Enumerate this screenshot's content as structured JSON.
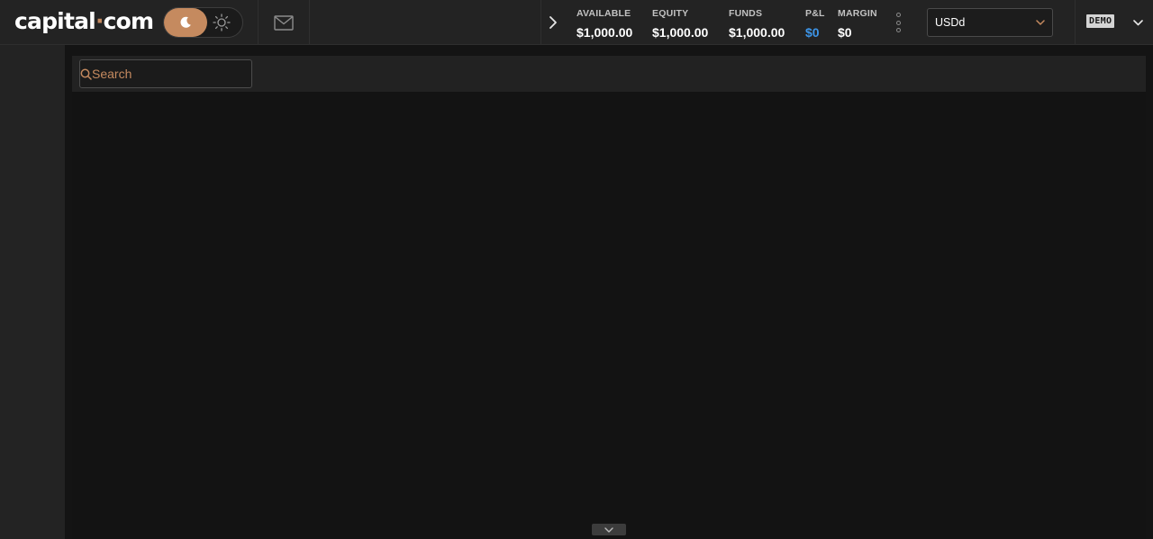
{
  "header": {
    "logo": {
      "prefix": "capital",
      "dot": "·",
      "suffix": "com"
    },
    "theme_toggle": {
      "active": "dark",
      "active_icon": "moon-icon",
      "inactive_icon": "sun-icon"
    },
    "mail_icon": "envelope-icon",
    "collapse_icon": "chevron-right-icon",
    "stats": [
      {
        "label": "AVAILABLE",
        "value": "$1,000.00"
      },
      {
        "label": "EQUITY",
        "value": "$1,000.00"
      },
      {
        "label": "FUNDS",
        "value": "$1,000.00"
      },
      {
        "label": "P&L",
        "value": "$0"
      },
      {
        "label": "MARGIN",
        "value": "$0"
      }
    ],
    "more_icon": "kebab-menu-icon",
    "account_select": {
      "value": "USDd"
    },
    "demo_badge": "DEMO"
  },
  "search": {
    "placeholder": "Search",
    "value": ""
  },
  "colors": {
    "accent": "#c58a5f",
    "pnl": "#3d95e8",
    "topbar_bg": "#232323",
    "page_bg": "#141414"
  }
}
